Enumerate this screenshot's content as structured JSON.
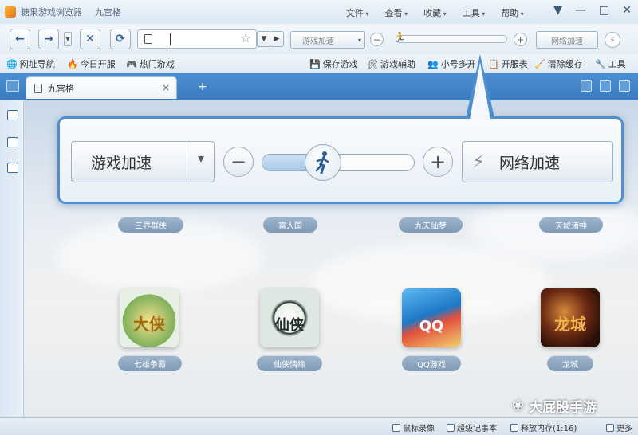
{
  "window": {
    "app_title": "糖果游戏浏览器",
    "doc_title": "九宫格",
    "menus": [
      "文件",
      "查看",
      "收藏",
      "工具",
      "帮助"
    ],
    "controls": [
      "▼",
      "—",
      "□",
      "✕"
    ]
  },
  "nav": {
    "back": "←",
    "forward": "→",
    "stop": "✕",
    "refresh": "⟳",
    "address_value": "",
    "mini_accel_label": "游戏加速",
    "mini_minus": "−",
    "mini_plus": "+",
    "mini_net_label": "网络加速",
    "bolt": "⚡"
  },
  "bookmarks": {
    "left": [
      {
        "label": "网址导航",
        "icon": "🌐"
      },
      {
        "label": "今日开服",
        "icon": "🔥"
      },
      {
        "label": "热门游戏",
        "icon": "🎮"
      }
    ],
    "right": [
      {
        "label": "保存游戏",
        "icon": "💾"
      },
      {
        "label": "游戏辅助",
        "icon": "🛠"
      },
      {
        "label": "小号多开",
        "icon": "👥"
      },
      {
        "label": "开服表",
        "icon": "📋"
      },
      {
        "label": "清除缓存",
        "icon": "🧹"
      },
      {
        "label": "工具",
        "icon": "🔧"
      }
    ]
  },
  "tabs": {
    "active_label": "九宫格",
    "close": "×",
    "new": "+"
  },
  "panel": {
    "accel_label": "游戏加速",
    "minus": "−",
    "plus": "+",
    "net_label": "网络加速",
    "bolt": "⚡",
    "speed_level": 0.4
  },
  "games_top": [
    "三界群侠",
    "富人国",
    "九天仙梦",
    "天域诸神"
  ],
  "games_bottom": [
    {
      "name": "七雄争霸",
      "art": "大侠"
    },
    {
      "name": "仙侠情缘",
      "art": "仙侠"
    },
    {
      "name": "QQ游戏",
      "art": "QQ"
    },
    {
      "name": "龙城",
      "art": "龙城"
    }
  ],
  "status": [
    {
      "label": "鼠标录像"
    },
    {
      "label": "超级记事本"
    },
    {
      "label": "释放内存(1:16)"
    },
    {
      "label": "更多"
    }
  ],
  "watermark": "大屁股手游"
}
